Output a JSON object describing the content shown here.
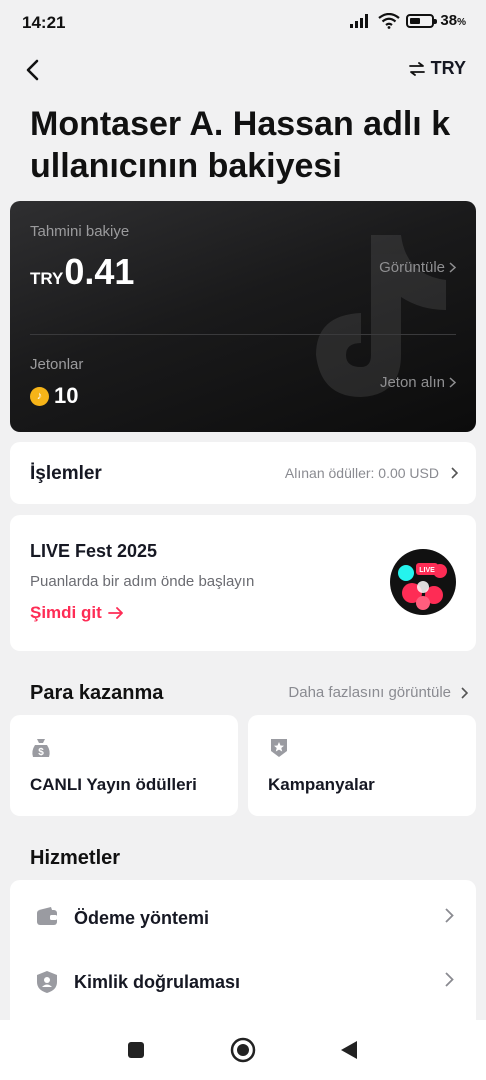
{
  "status_bar": {
    "time": "14:21",
    "battery_text": "38",
    "battery_unit": "%",
    "battery_level": 0.38
  },
  "header": {
    "currency_label": "TRY"
  },
  "title": "Montaser A. Hassan adlı kullanıcının bakiyesi",
  "balance_card": {
    "estimated_label": "Tahmini bakiye",
    "currency": "TRY",
    "amount": "0.41",
    "view_label": "Görüntüle",
    "coins_label": "Jetonlar",
    "coins_value": "10",
    "get_coins_label": "Jeton alın"
  },
  "transactions": {
    "label": "İşlemler",
    "rewards_text": "Alınan ödüller: 0.00 USD"
  },
  "live_fest": {
    "title": "LIVE Fest 2025",
    "subtitle": "Puanlarda bir adım önde başlayın",
    "cta": "Şimdi git",
    "badge_text": "LIVE"
  },
  "monetization": {
    "title": "Para kazanma",
    "more_label": "Daha fazlasını görüntüle",
    "items": [
      {
        "label": "CANLI Yayın ödülleri",
        "icon": "money-bag-icon"
      },
      {
        "label": "Kampanyalar",
        "icon": "badge-star-icon"
      }
    ]
  },
  "services": {
    "title": "Hizmetler",
    "items": [
      {
        "label": "Ödeme yöntemi",
        "icon": "wallet-icon"
      },
      {
        "label": "Kimlik doğrulaması",
        "icon": "shield-person-icon"
      }
    ]
  },
  "colors": {
    "accent": "#fe2c55",
    "card_dark": "#1a1a1b",
    "background": "#f1f1f2",
    "coin": "#f6b418"
  }
}
